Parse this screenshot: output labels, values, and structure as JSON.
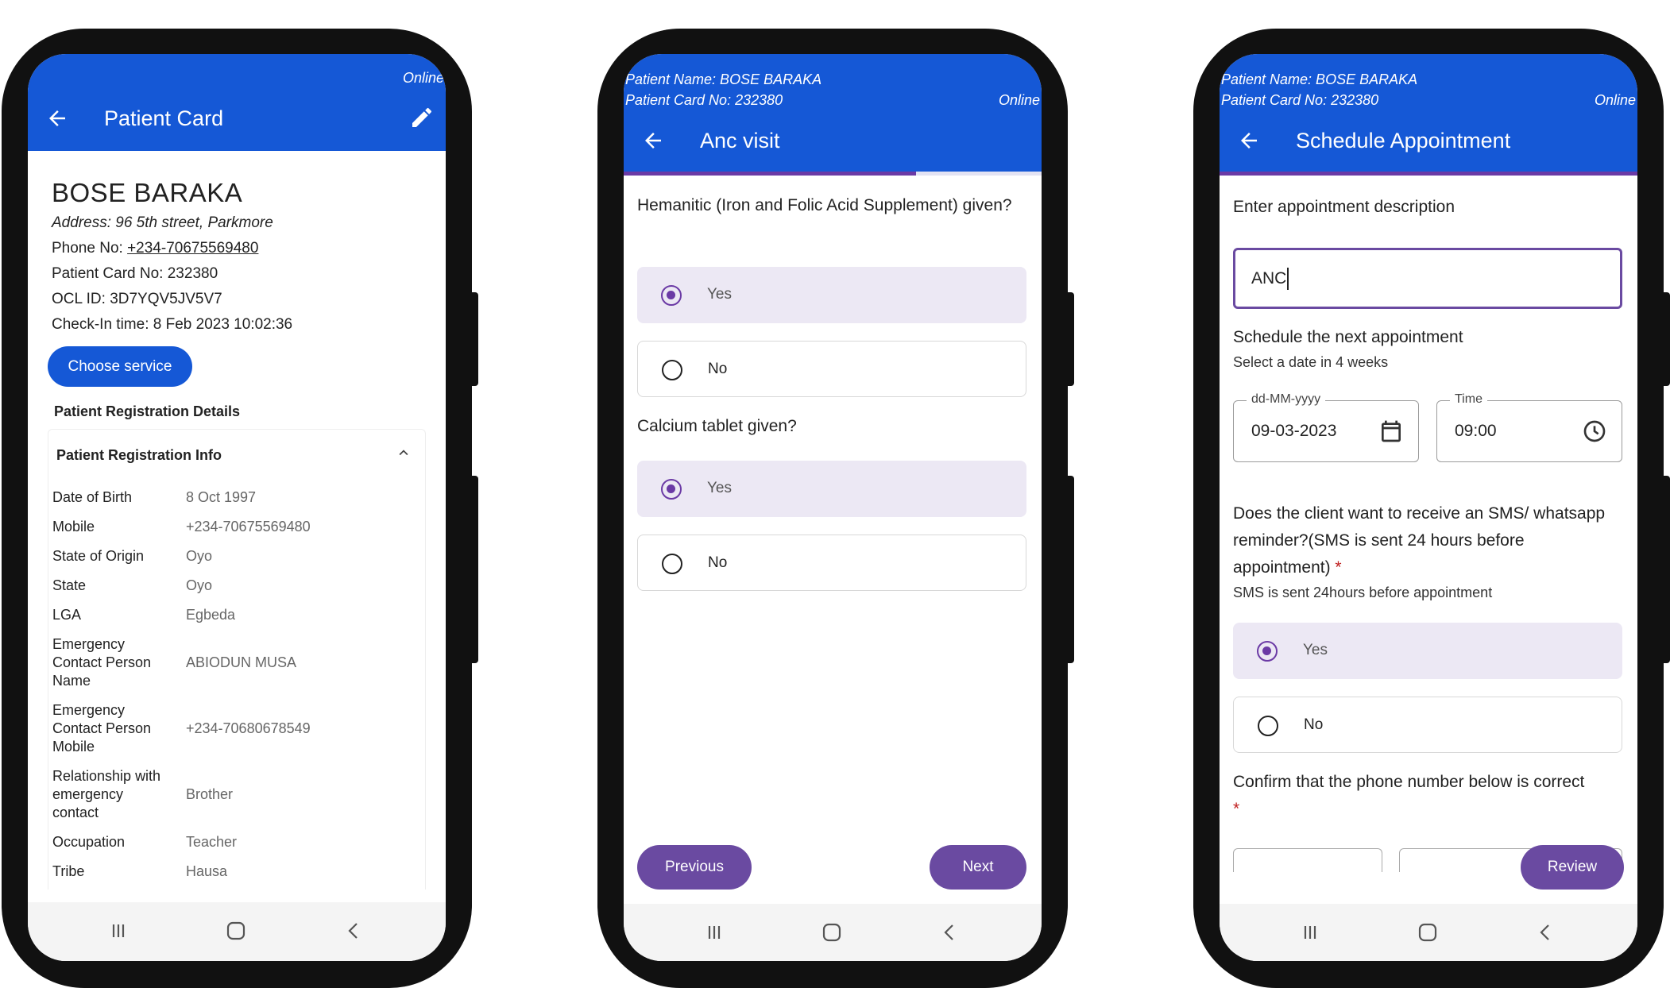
{
  "common": {
    "online": "Online",
    "patient_name_line": "Patient Name: BOSE BARAKA",
    "patient_card_line": "Patient Card No: 232380"
  },
  "screen1": {
    "title": "Patient Card",
    "name": "BOSE BARAKA",
    "address": "Address: 96 5th street, Parkmore",
    "phone_label": "Phone No: ",
    "phone_value": "+234-70675569480",
    "card_no": "Patient Card No: 232380",
    "ocl_id": "OCL ID: 3D7YQV5JV5V7",
    "checkin": "Check-In time: 8 Feb 2023 10:02:36",
    "choose_service": "Choose service",
    "section_label": "Patient Registration Details",
    "card_title": "Patient Registration Info",
    "rows": [
      {
        "k": "Date of Birth",
        "v": "8 Oct 1997"
      },
      {
        "k": "Mobile",
        "v": "+234-70675569480"
      },
      {
        "k": "State of Origin",
        "v": "Oyo"
      },
      {
        "k": "State",
        "v": "Oyo"
      },
      {
        "k": "LGA",
        "v": "Egbeda"
      },
      {
        "k": "Emergency Contact Person Name",
        "v": "ABIODUN MUSA"
      },
      {
        "k": "Emergency Contact Person Mobile",
        "v": "+234-70680678549"
      },
      {
        "k": "Relationship with emergency contact",
        "v": "Brother"
      },
      {
        "k": "Occupation",
        "v": "Teacher"
      },
      {
        "k": "Tribe",
        "v": "Hausa"
      }
    ]
  },
  "screen2": {
    "title": "Anc visit",
    "progress": 0.7,
    "q1": "Hemanitic (Iron and Folic Acid Supplement) given?",
    "q2": "Calcium tablet given?",
    "yes": "Yes",
    "no": "No",
    "previous": "Previous",
    "next": "Next"
  },
  "screen3": {
    "title": "Schedule Appointment",
    "progress": 1.0,
    "desc_label": "Enter appointment description",
    "desc_value": "ANC",
    "schedule_label": "Schedule the next appointment",
    "schedule_hint": "Select a date in 4 weeks",
    "date_label": "dd-MM-yyyy",
    "date_value": "09-03-2023",
    "time_label": "Time",
    "time_value": "09:00",
    "sms_question": "Does the client want to receive an SMS/ whatsapp reminder?(SMS is sent 24 hours before appointment)",
    "required_mark": "*",
    "sms_hint": "SMS is sent 24hours before appointment",
    "yes": "Yes",
    "no": "No",
    "confirm_phone": "Confirm that the phone number below is correct",
    "review": "Review"
  }
}
